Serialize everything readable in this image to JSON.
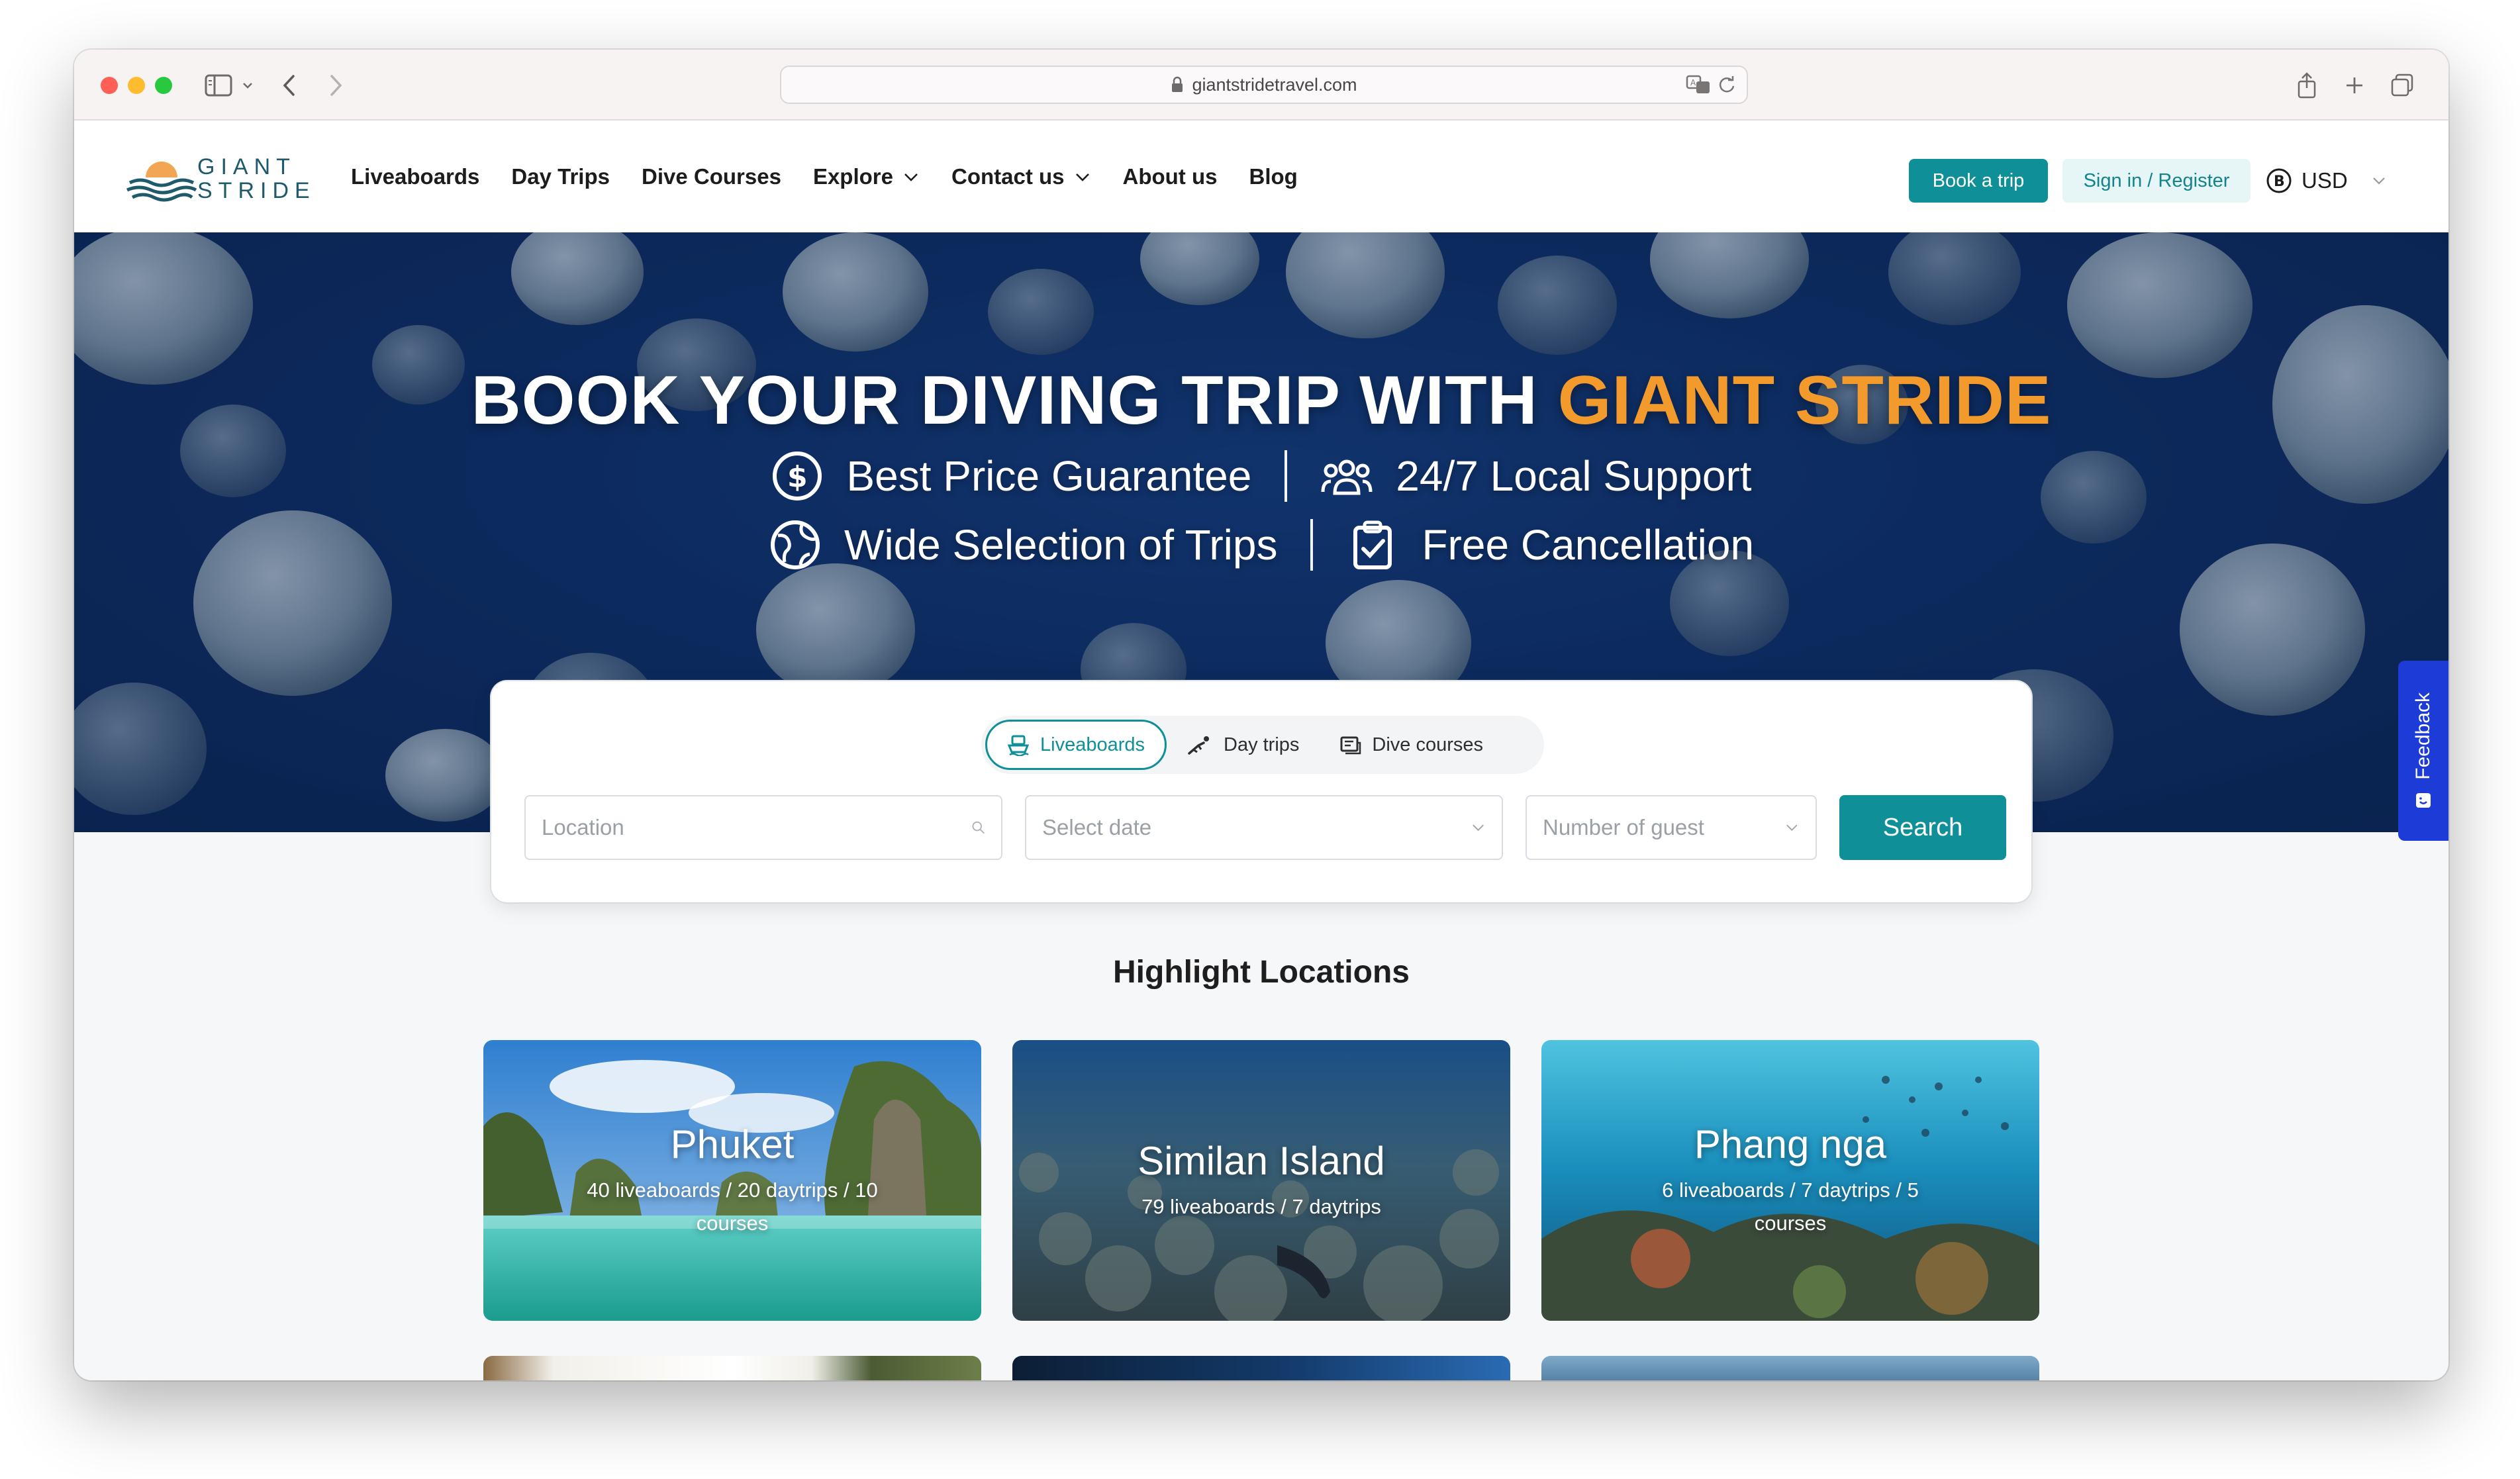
{
  "browser": {
    "url": "giantstridetravel.com"
  },
  "header": {
    "logo_line1": "GIANT",
    "logo_line2": "STRIDE",
    "nav": [
      {
        "label": "Liveaboards",
        "dropdown": false
      },
      {
        "label": "Day Trips",
        "dropdown": false
      },
      {
        "label": "Dive Courses",
        "dropdown": false
      },
      {
        "label": "Explore",
        "dropdown": true
      },
      {
        "label": "Contact us",
        "dropdown": true
      },
      {
        "label": "About us",
        "dropdown": false
      },
      {
        "label": "Blog",
        "dropdown": false
      }
    ],
    "book_label": "Book a trip",
    "signin_label": "Sign in / Register",
    "currency": "USD"
  },
  "hero": {
    "title_main": "BOOK YOUR DIVING TRIP WITH ",
    "title_accent": "GIANT STRIDE",
    "features": [
      {
        "icon": "dollar-circle-icon",
        "label": "Best Price Guarantee"
      },
      {
        "icon": "people-group-icon",
        "label": "24/7 Local Support"
      },
      {
        "icon": "globe-icon",
        "label": "Wide Selection of Trips"
      },
      {
        "icon": "clipboard-check-icon",
        "label": "Free Cancellation"
      }
    ],
    "slide_count": 4,
    "active_slide": 1
  },
  "search": {
    "tabs": [
      {
        "label": "Liveaboards",
        "icon": "ship-icon",
        "active": true
      },
      {
        "label": "Day trips",
        "icon": "diver-icon",
        "active": false
      },
      {
        "label": "Dive courses",
        "icon": "course-book-icon",
        "active": false
      }
    ],
    "location_placeholder": "Location",
    "date_placeholder": "Select date",
    "guest_placeholder": "Number of guest",
    "search_label": "Search"
  },
  "feedback_label": "Feedback",
  "highlights": {
    "title": "Highlight Locations",
    "cards": [
      {
        "name": "Phuket",
        "meta": "40 liveaboards / 20 daytrips / 10 courses"
      },
      {
        "name": "Similan Island",
        "meta": "79 liveaboards / 7 daytrips"
      },
      {
        "name": "Phang nga",
        "meta": "6 liveaboards / 7 daytrips / 5 courses"
      }
    ]
  },
  "colors": {
    "brand_teal": "#0f8f97",
    "accent_orange": "#f39a2c",
    "feedback_blue": "#1d3bd6"
  }
}
